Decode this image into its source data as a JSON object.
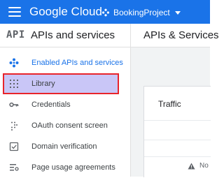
{
  "topbar": {
    "brand": "Google Cloud",
    "project_name": "BookingProject",
    "menu_icon": "hamburger-menu-icon",
    "project_icon": "project-hexagon-icon"
  },
  "left_panel": {
    "logo_text": "API",
    "title": "APIs and services",
    "items": [
      {
        "label": "Enabled APIs and services",
        "icon": "enabled-apis-icon",
        "state": "active"
      },
      {
        "label": "Library",
        "icon": "library-grid-icon",
        "state": "selected"
      },
      {
        "label": "Credentials",
        "icon": "key-icon",
        "state": "normal"
      },
      {
        "label": "OAuth consent screen",
        "icon": "oauth-dots-icon",
        "state": "normal"
      },
      {
        "label": "Domain verification",
        "icon": "domain-checkbox-icon",
        "state": "normal"
      },
      {
        "label": "Page usage agreements",
        "icon": "settings-list-icon",
        "state": "normal"
      }
    ]
  },
  "main": {
    "title": "APIs & Services",
    "card_title": "Traffic",
    "warning_text": "No"
  },
  "colors": {
    "brand_blue": "#1a73e8",
    "selected_bg": "#c9c6f7",
    "highlight_border": "#e8242b"
  }
}
